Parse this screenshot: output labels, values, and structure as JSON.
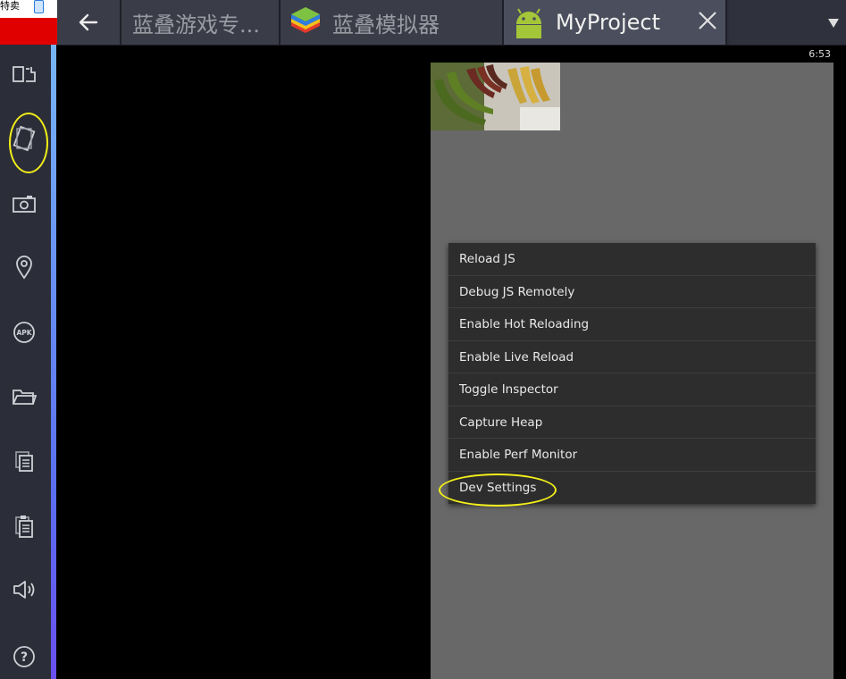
{
  "corner": {
    "text": "特卖"
  },
  "tabs": [
    {
      "label": "蓝叠游戏专...",
      "active": false
    },
    {
      "label": "蓝叠模拟器",
      "active": false
    },
    {
      "label": "MyProject",
      "active": true
    }
  ],
  "status": {
    "time": "6:53"
  },
  "sidebar": {
    "items": [
      {
        "icon": "dual-screen-icon"
      },
      {
        "icon": "rotate-screen-icon",
        "highlighted": true
      },
      {
        "icon": "camera-icon"
      },
      {
        "icon": "location-pin-icon"
      },
      {
        "icon": "apk-install-icon",
        "text": "APK"
      },
      {
        "icon": "folder-icon"
      },
      {
        "icon": "copy-icon"
      },
      {
        "icon": "paste-icon"
      },
      {
        "icon": "volume-icon"
      },
      {
        "icon": "help-icon",
        "text": "?"
      }
    ]
  },
  "devmenu": {
    "items": [
      "Reload JS",
      "Debug JS Remotely",
      "Enable Hot Reloading",
      "Enable Live Reload",
      "Toggle Inspector",
      "Capture Heap",
      "Enable Perf Monitor",
      "Dev Settings"
    ],
    "highlighted": "Dev Settings"
  },
  "colors": {
    "highlight": "#f2ee1a",
    "menu_bg": "#2d2d2d",
    "screen_bg": "#686868",
    "sidebar_bg": "#2b2d38"
  }
}
